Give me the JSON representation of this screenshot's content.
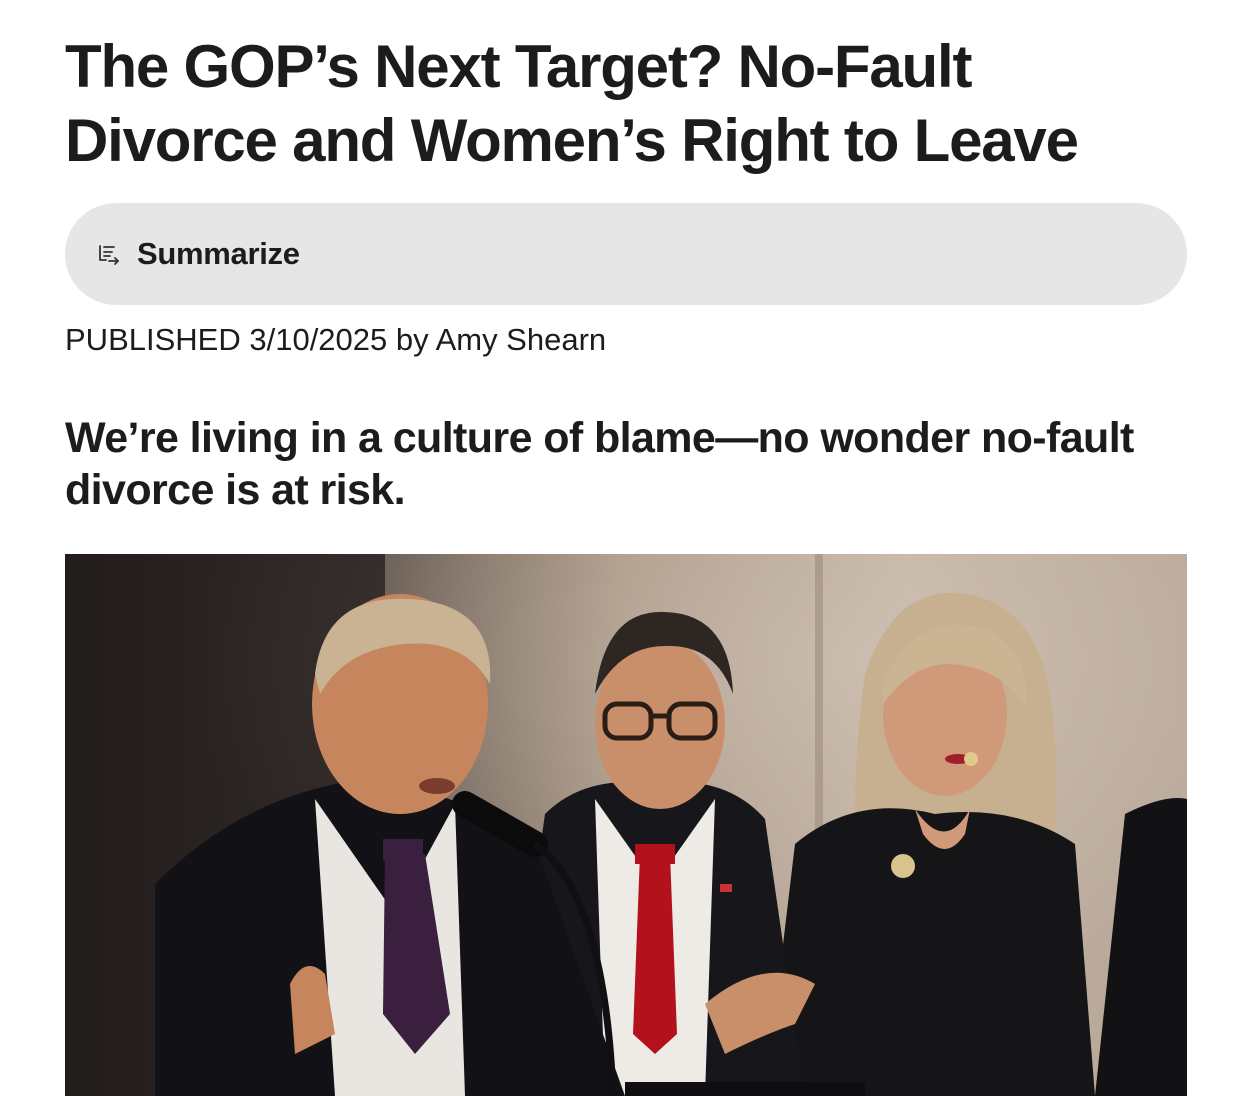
{
  "article": {
    "headline": "The GOP’s Next Target? No-Fault Divorce and Women’s Right to Leave",
    "summarize": {
      "label": "Summarize",
      "icon": "summarize-icon"
    },
    "byline": {
      "published_label": "PUBLISHED",
      "date": "3/10/2025",
      "by_label": "by",
      "author": "Amy Shearn"
    },
    "dek": "We’re living in a culture of blame—no wonder no-fault divorce is at risk.",
    "hero_image": {
      "description_icon": "photo",
      "colors": {
        "background_dark": "#2a2624",
        "wall": "#b9aa9c",
        "suit": "#141418",
        "tie_red": "#b3121c",
        "tie_purple": "#3a1f3e",
        "skin": "#c98f6a",
        "hair_blonde": "#c9b392",
        "hair_dark": "#2e2622"
      }
    }
  }
}
